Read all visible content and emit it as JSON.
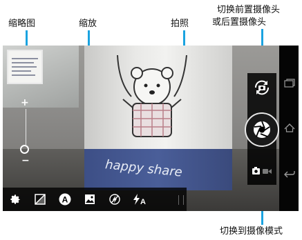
{
  "callouts": {
    "thumbnail": "缩略图",
    "zoom": "缩放",
    "shutter": "拍照",
    "switch_camera_line1": "切换前置摄像头",
    "switch_camera_line2": "或后置摄像头",
    "switch_mode": "切换到摄像模式"
  },
  "viewfinder": {
    "cup_text": "happy share"
  },
  "zoom": {
    "plus": "+",
    "minus": "−"
  },
  "toolbar": {
    "items": [
      {
        "icon": "gear-icon"
      },
      {
        "icon": "exposure-icon"
      },
      {
        "icon": "auto-mode-icon",
        "text": "A"
      },
      {
        "icon": "scene-icon"
      },
      {
        "icon": "flash-off-icon"
      },
      {
        "icon": "flash-auto-icon",
        "text": "A"
      }
    ]
  },
  "colors": {
    "callout_line": "#1aa3e0",
    "panel_bg": "#000000",
    "icon": "#ffffff"
  }
}
